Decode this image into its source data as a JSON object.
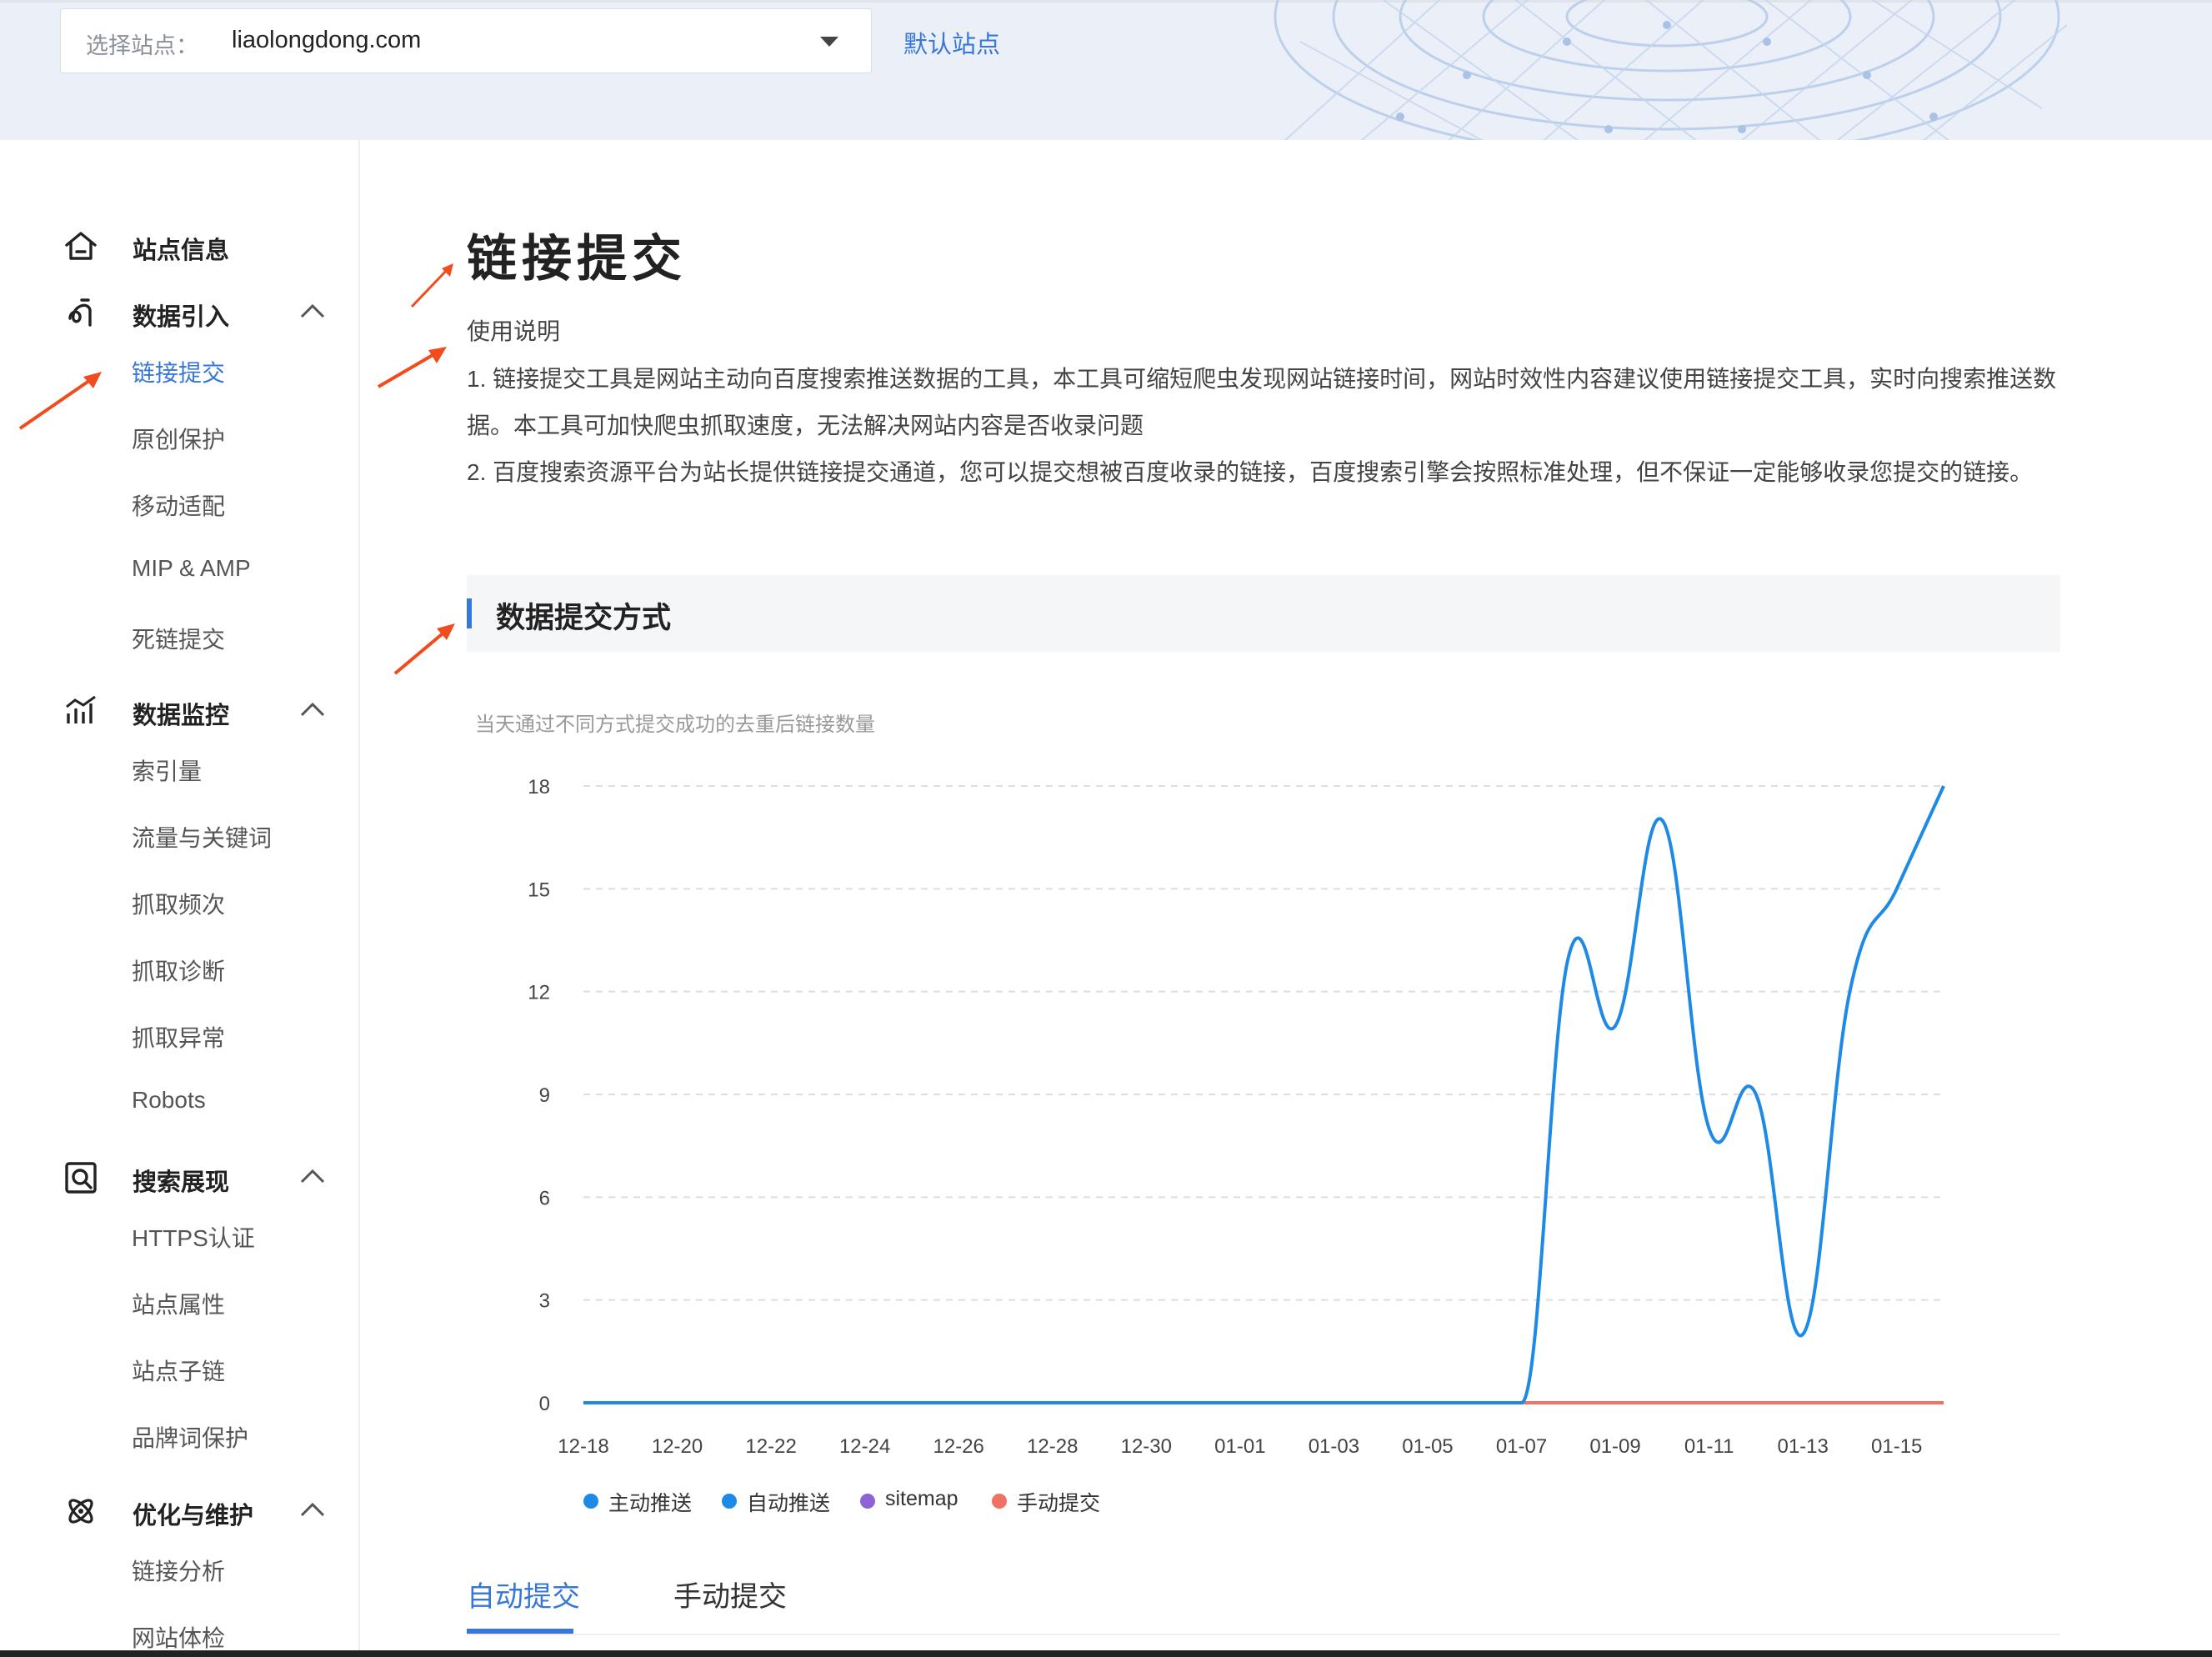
{
  "header": {
    "site_select_label": "选择站点：",
    "site_select_value": "liaolongdong.com",
    "default_site_link": "默认站点"
  },
  "sidebar": {
    "groups": [
      {
        "title": "站点信息",
        "icon": "home-icon",
        "items": []
      },
      {
        "title": "数据引入",
        "icon": "data-import-icon",
        "expanded": true,
        "items": [
          "链接提交",
          "原创保护",
          "移动适配",
          "MIP & AMP",
          "死链提交"
        ],
        "active_item": "链接提交"
      },
      {
        "title": "数据监控",
        "icon": "data-monitor-icon",
        "expanded": true,
        "items": [
          "索引量",
          "流量与关键词",
          "抓取频次",
          "抓取诊断",
          "抓取异常",
          "Robots"
        ]
      },
      {
        "title": "搜索展现",
        "icon": "search-display-icon",
        "expanded": true,
        "items": [
          "HTTPS认证",
          "站点属性",
          "站点子链",
          "品牌词保护"
        ]
      },
      {
        "title": "优化与维护",
        "icon": "optimize-icon",
        "expanded": true,
        "items": [
          "链接分析",
          "网站体检"
        ]
      }
    ]
  },
  "main": {
    "page_title": "链接提交",
    "usage": {
      "title": "使用说明",
      "lines": [
        "1. 链接提交工具是网站主动向百度搜索推送数据的工具，本工具可缩短爬虫发现网站链接时间，网站时效性内容建议使用链接提交工具，实时向搜索推送数",
        "据。本工具可加快爬虫抓取速度，无法解决网站内容是否收录问题",
        "2. 百度搜索资源平台为站长提供链接提交通道，您可以提交想被百度收录的链接，百度搜索引擎会按照标准处理，但不保证一定能够收录您提交的链接。"
      ]
    },
    "section_title": "数据提交方式",
    "chart_subtitle": "当天通过不同方式提交成功的去重后链接数量",
    "tabs": [
      "自动提交",
      "手动提交"
    ],
    "active_tab": "自动提交"
  },
  "colors": {
    "accent": "#3777d7",
    "series_blue": "#1f8ae6",
    "series_red": "#f07165",
    "series_purple": "#8e63d6",
    "arrow": "#f24b1d"
  },
  "chart_data": {
    "type": "line",
    "title": "当天通过不同方式提交成功的去重后链接数量",
    "xlabel": "",
    "ylabel": "",
    "categories": [
      "12-18",
      "12-19",
      "12-20",
      "12-21",
      "12-22",
      "12-23",
      "12-24",
      "12-25",
      "12-26",
      "12-27",
      "12-28",
      "12-29",
      "12-30",
      "12-31",
      "01-01",
      "01-02",
      "01-03",
      "01-04",
      "01-05",
      "01-06",
      "01-07",
      "01-08",
      "01-09",
      "01-10",
      "01-11",
      "01-12",
      "01-13",
      "01-14",
      "01-15",
      "01-16"
    ],
    "tick_labels": [
      "12-18",
      "12-20",
      "12-22",
      "12-24",
      "12-26",
      "12-28",
      "12-30",
      "01-01",
      "01-03",
      "01-05",
      "01-07",
      "01-09",
      "01-11",
      "01-13",
      "01-15"
    ],
    "yticks": [
      0,
      3,
      6,
      9,
      12,
      15,
      18
    ],
    "ylim": [
      0,
      18
    ],
    "grid": true,
    "legend_position": "bottom-left",
    "series": [
      {
        "name": "主动推送",
        "color": "#1f8ae6",
        "values": [
          0,
          0,
          0,
          0,
          0,
          0,
          0,
          0,
          0,
          0,
          0,
          0,
          0,
          0,
          0,
          0,
          0,
          0,
          0,
          0,
          0,
          13,
          11,
          17,
          8,
          9,
          2,
          12,
          15,
          18
        ]
      },
      {
        "name": "自动推送",
        "color": "#1f8ae6",
        "values": [
          0,
          0,
          0,
          0,
          0,
          0,
          0,
          0,
          0,
          0,
          0,
          0,
          0,
          0,
          0,
          0,
          0,
          0,
          0,
          0,
          0,
          0,
          0,
          0,
          0,
          0,
          0,
          0,
          0,
          0
        ]
      },
      {
        "name": "sitemap",
        "color": "#8e63d6",
        "values": [
          0,
          0,
          0,
          0,
          0,
          0,
          0,
          0,
          0,
          0,
          0,
          0,
          0,
          0,
          0,
          0,
          0,
          0,
          0,
          0,
          0,
          0,
          0,
          0,
          0,
          0,
          0,
          0,
          0,
          0
        ]
      },
      {
        "name": "手动提交",
        "color": "#f07165",
        "values": [
          0,
          0,
          0,
          0,
          0,
          0,
          0,
          0,
          0,
          0,
          0,
          0,
          0,
          0,
          0,
          0,
          0,
          0,
          0,
          0,
          0,
          0,
          0,
          0,
          0,
          0,
          0,
          0,
          0,
          0
        ]
      }
    ]
  }
}
